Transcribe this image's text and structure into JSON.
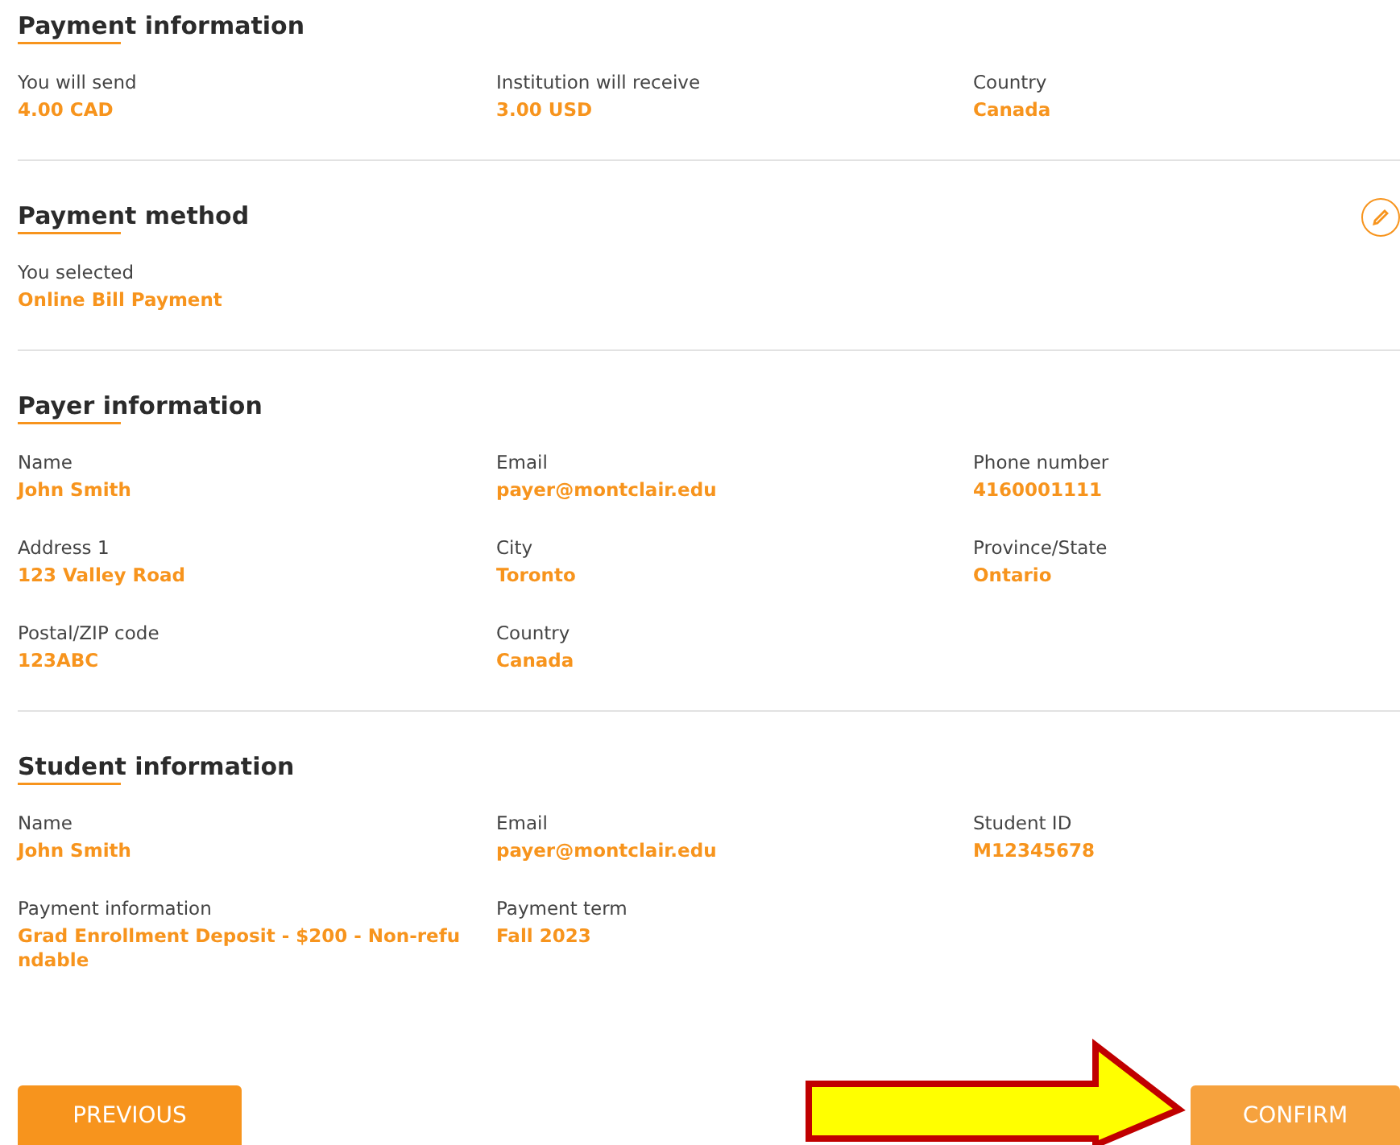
{
  "sections": [
    {
      "title": "Payment information",
      "editable": false,
      "rows": [
        [
          {
            "label": "You will send",
            "value": "4.00 CAD"
          },
          {
            "label": "Institution will receive",
            "value": "3.00 USD"
          },
          {
            "label": "Country",
            "value": "Canada"
          }
        ]
      ]
    },
    {
      "title": "Payment method",
      "editable": true,
      "rows": [
        [
          {
            "label": "You selected",
            "value": "Online Bill Payment"
          }
        ]
      ]
    },
    {
      "title": "Payer information",
      "editable": false,
      "rows": [
        [
          {
            "label": "Name",
            "value": "John Smith"
          },
          {
            "label": "Email",
            "value": "payer@montclair.edu"
          },
          {
            "label": "Phone number",
            "value": "4160001111"
          }
        ],
        [
          {
            "label": "Address 1",
            "value": "123 Valley Road"
          },
          {
            "label": "City",
            "value": "Toronto"
          },
          {
            "label": "Province/State",
            "value": "Ontario"
          }
        ],
        [
          {
            "label": "Postal/ZIP code",
            "value": "123ABC"
          },
          {
            "label": "Country",
            "value": "Canada"
          }
        ]
      ]
    },
    {
      "title": "Student information",
      "editable": false,
      "rows": [
        [
          {
            "label": "Name",
            "value": "John Smith"
          },
          {
            "label": "Email",
            "value": "payer@montclair.edu"
          },
          {
            "label": "Student ID",
            "value": "M12345678"
          }
        ],
        [
          {
            "label": "Payment information",
            "value": "Grad Enrollment Deposit - $200 - Non-refundable"
          },
          {
            "label": "Payment term",
            "value": "Fall 2023"
          }
        ]
      ]
    }
  ],
  "buttons": [
    {
      "label": "PREVIOUS",
      "kind": "secondary"
    },
    {
      "label": "CONFIRM",
      "kind": "primary"
    }
  ]
}
